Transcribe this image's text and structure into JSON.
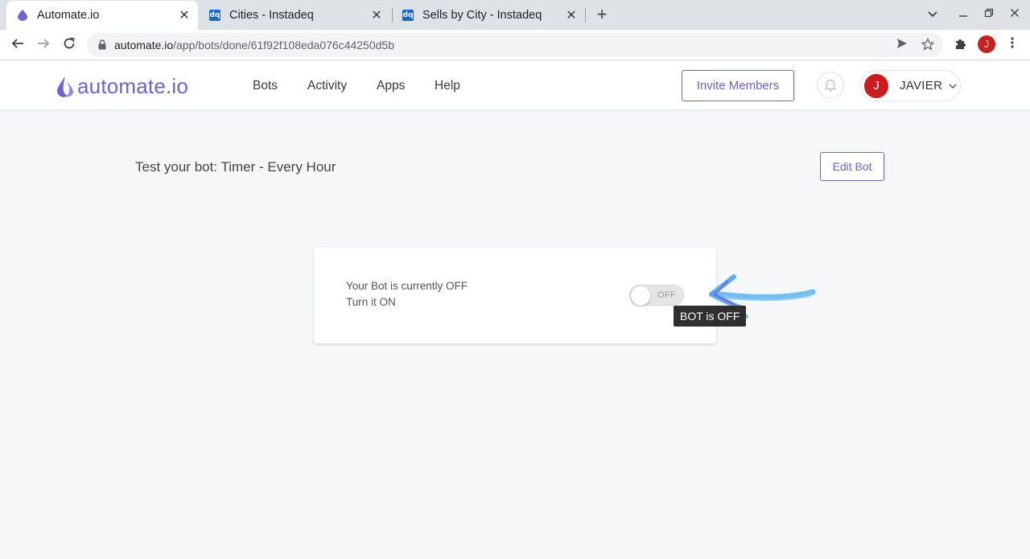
{
  "browser": {
    "tabs": [
      {
        "title": "Automate.io",
        "active": true
      },
      {
        "title": "Cities - Instadeq",
        "active": false
      },
      {
        "title": "Sells by City - Instadeq",
        "active": false
      }
    ],
    "favicon_dq": "dq",
    "new_tab": "+",
    "url_host": "automate.io",
    "url_path": "/app/bots/done/61f92f108eda076c44250d5b",
    "profile_initial": "J"
  },
  "app": {
    "logo_text": "automate.io",
    "nav": [
      "Bots",
      "Activity",
      "Apps",
      "Help"
    ],
    "invite_label": "Invite Members",
    "user_initial": "J",
    "user_name": "JAVIER",
    "accent_color": "#6d63d6"
  },
  "main": {
    "title": "Test your bot: Timer - Every Hour",
    "edit_label": "Edit Bot",
    "status_line1": "Your Bot is currently OFF",
    "status_line2": "Turn it ON",
    "toggle_label": "OFF",
    "tooltip": "BOT is OFF",
    "arrow_color": "#5bb4ee"
  }
}
